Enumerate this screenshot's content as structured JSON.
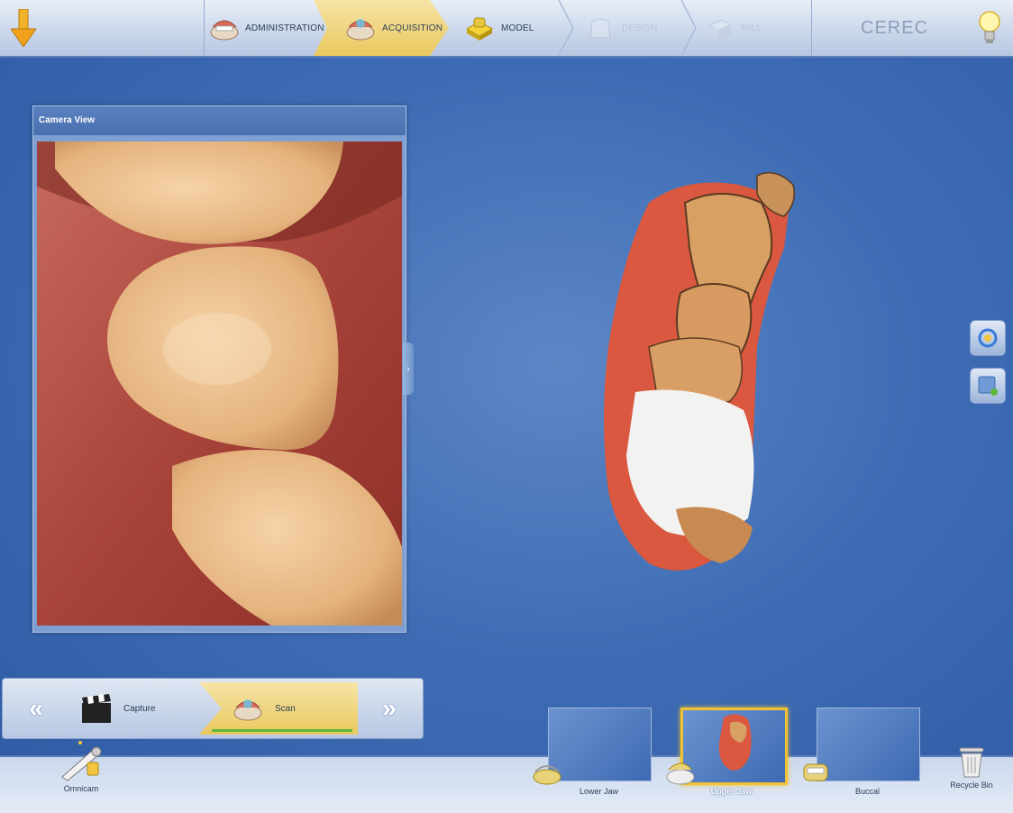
{
  "workflow": {
    "steps": [
      {
        "label": "ADMINISTRATION",
        "state": "done",
        "icon": "jaw-model-icon"
      },
      {
        "label": "ACQUISITION",
        "state": "active",
        "icon": "scan-jaw-icon"
      },
      {
        "label": "MODEL",
        "state": "done",
        "icon": "model-block-icon"
      },
      {
        "label": "DESIGN",
        "state": "disabled",
        "icon": "design-crown-icon"
      },
      {
        "label": "MILL",
        "state": "disabled",
        "icon": "mill-block-icon"
      }
    ],
    "brand": "CEREC"
  },
  "camera_panel": {
    "title": "Camera View"
  },
  "scan_controls": {
    "capture_label": "Capture",
    "scan_label": "Scan",
    "prev_symbol": "«",
    "next_symbol": "»",
    "expand_symbol": "›"
  },
  "bottom": {
    "camera_label": "Omnicam",
    "thumbnails": [
      {
        "label": "Lower Jaw",
        "selected": false
      },
      {
        "label": "Upper Jaw",
        "selected": true
      },
      {
        "label": "Buccal",
        "selected": false
      }
    ],
    "recycle_label": "Recycle Bin"
  },
  "colors": {
    "accent": "#e9c85e",
    "background": "#3f6db5",
    "progress": "#5cb83a",
    "selected_border": "#f1c232"
  }
}
